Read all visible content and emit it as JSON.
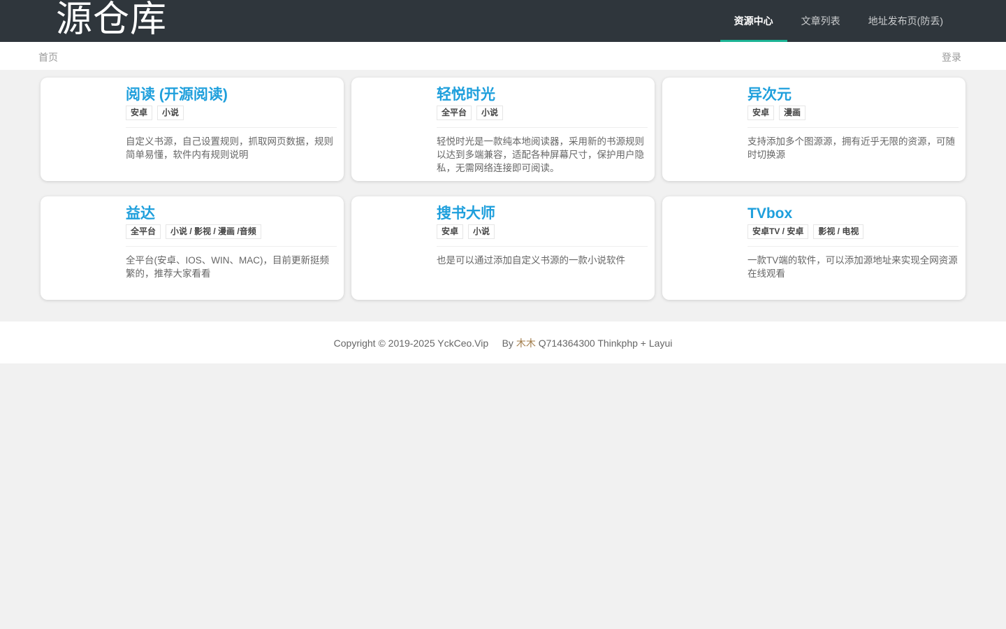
{
  "header": {
    "logo": "源仓库",
    "nav": [
      "资源中心",
      "文章列表",
      "地址发布页(防丢)"
    ],
    "active_nav": 0
  },
  "subbar": {
    "home": "首页",
    "login": "登录"
  },
  "cards": [
    {
      "title": "阅读 (开源阅读)",
      "tags": [
        "安卓",
        "小说"
      ],
      "desc": "自定义书源，自己设置规则，抓取网页数据，规则简单易懂，软件内有规则说明"
    },
    {
      "title": "轻悦时光",
      "tags": [
        "全平台",
        "小说"
      ],
      "desc": "轻悦时光是一款纯本地阅读器，采用新的书源规则以达到多端兼容，适配各种屏幕尺寸，保护用户隐私，无需网络连接即可阅读。"
    },
    {
      "title": "异次元",
      "tags": [
        "安卓",
        "漫画"
      ],
      "desc": "支持添加多个图源源，拥有近乎无限的资源，可随时切换源"
    },
    {
      "title": "益达",
      "tags": [
        "全平台",
        "小说 / 影视 / 漫画 /音频"
      ],
      "desc": "全平台(安卓、IOS、WIN、MAC)，目前更新挺频繁的，推荐大家看看"
    },
    {
      "title": "搜书大师",
      "tags": [
        "安卓",
        "小说"
      ],
      "desc": "也是可以通过添加自定义书源的一款小说软件"
    },
    {
      "title": "TVbox",
      "tags": [
        "安卓TV / 安卓",
        "影视 / 电视"
      ],
      "desc": "一款TV端的软件，可以添加源地址来实现全网资源在线观看"
    }
  ],
  "footer": {
    "copyright": "Copyright © 2019-2025 YckCeo.Vip",
    "by": "By",
    "author": "木木",
    "contact": "Q714364300 Thinkphp + Layui"
  }
}
